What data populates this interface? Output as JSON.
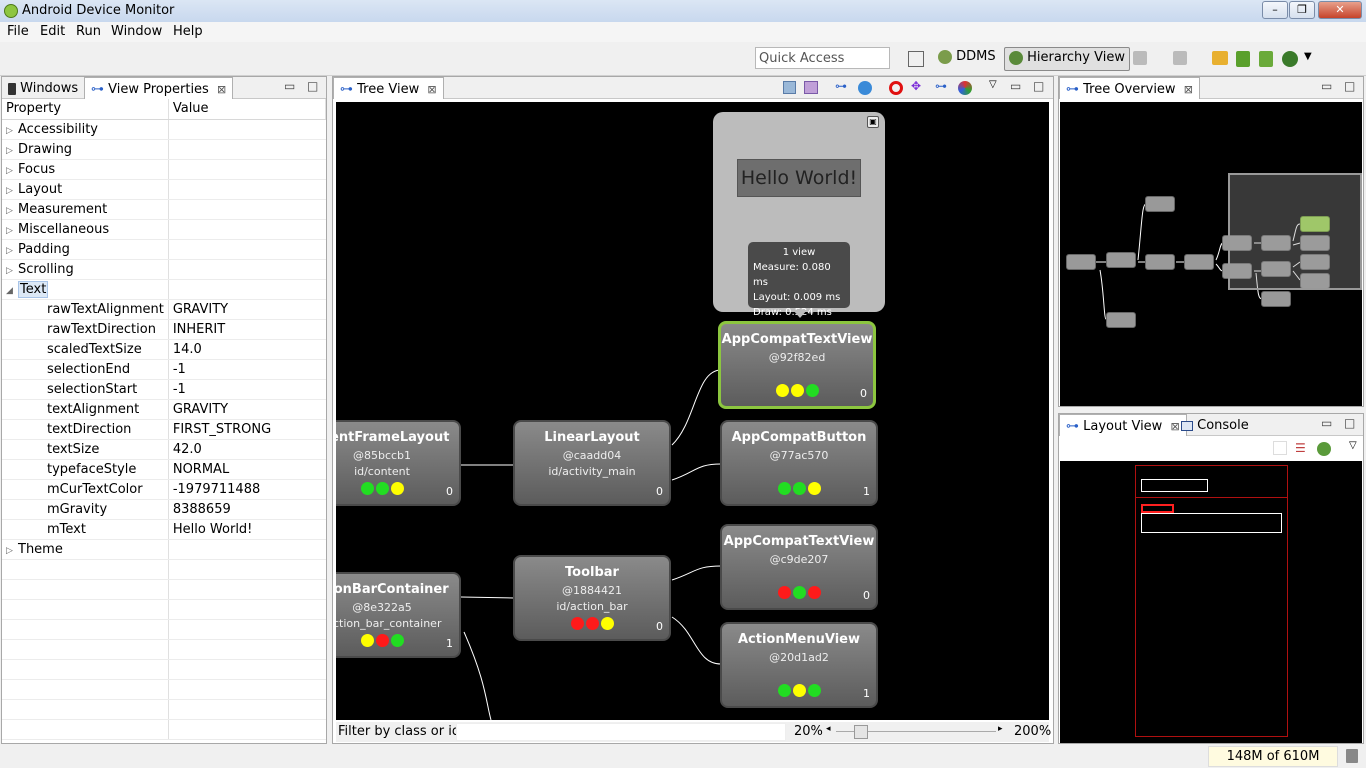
{
  "window": {
    "title": "Android Device Monitor",
    "min": "–",
    "max": "❐",
    "close": "✕"
  },
  "menu": [
    "File",
    "Edit",
    "Run",
    "Window",
    "Help"
  ],
  "toolbar": {
    "quick_access_placeholder": "Quick Access",
    "ddms": "DDMS",
    "hierarchy_view": "Hierarchy View"
  },
  "left": {
    "tabs": [
      "Windows",
      "View Properties"
    ],
    "columns": [
      "Property",
      "Value"
    ],
    "categories_collapsed": [
      "Accessibility",
      "Drawing",
      "Focus",
      "Layout",
      "Measurement",
      "Miscellaneous",
      "Padding",
      "Scrolling"
    ],
    "expanded_category": "Text",
    "text_props": [
      {
        "name": "rawTextAlignment",
        "value": "GRAVITY"
      },
      {
        "name": "rawTextDirection",
        "value": "INHERIT"
      },
      {
        "name": "scaledTextSize",
        "value": "14.0"
      },
      {
        "name": "selectionEnd",
        "value": "-1"
      },
      {
        "name": "selectionStart",
        "value": "-1"
      },
      {
        "name": "textAlignment",
        "value": "GRAVITY"
      },
      {
        "name": "textDirection",
        "value": "FIRST_STRONG"
      },
      {
        "name": "textSize",
        "value": "42.0"
      },
      {
        "name": "typefaceStyle",
        "value": "NORMAL"
      },
      {
        "name": "mCurTextColor",
        "value": "-1979711488"
      },
      {
        "name": "mGravity",
        "value": "8388659"
      },
      {
        "name": "mText",
        "value": "Hello World!"
      }
    ],
    "last_category": "Theme"
  },
  "tree": {
    "tab": "Tree View",
    "preview_text": "Hello World!",
    "tooltip": {
      "line1": "1 view",
      "line2": "Measure: 0.080 ms",
      "line3": "Layout: 0.009 ms",
      "line4": "Draw: 0.524 ms"
    },
    "nodes": {
      "content": {
        "name": "ntentFrameLayout",
        "hash": "@85bccb1",
        "res": "id/content",
        "index": "0"
      },
      "linear": {
        "name": "LinearLayout",
        "hash": "@caadd04",
        "res": "id/activity_main",
        "index": "0"
      },
      "text1": {
        "name": "AppCompatTextView",
        "hash": "@92f82ed",
        "index": "0"
      },
      "button": {
        "name": "AppCompatButton",
        "hash": "@77ac570",
        "index": "1"
      },
      "abc": {
        "name": "ctionBarContainer",
        "hash": "@8e322a5",
        "res": "/action_bar_container",
        "index": "1"
      },
      "toolbar": {
        "name": "Toolbar",
        "hash": "@1884421",
        "res": "id/action_bar",
        "index": "0"
      },
      "text2": {
        "name": "AppCompatTextView",
        "hash": "@c9de207",
        "index": "0"
      },
      "menu": {
        "name": "ActionMenuView",
        "hash": "@20d1ad2",
        "index": "1"
      }
    },
    "filter_label": "Filter by class or id:",
    "zoom_min": "20%",
    "zoom_max": "200%",
    "zoom_level": 0.12
  },
  "overview": {
    "tab": "Tree Overview"
  },
  "bottom_right": {
    "tabs": [
      "Layout View",
      "Console"
    ]
  },
  "status": {
    "memory": "148M of 610M"
  }
}
